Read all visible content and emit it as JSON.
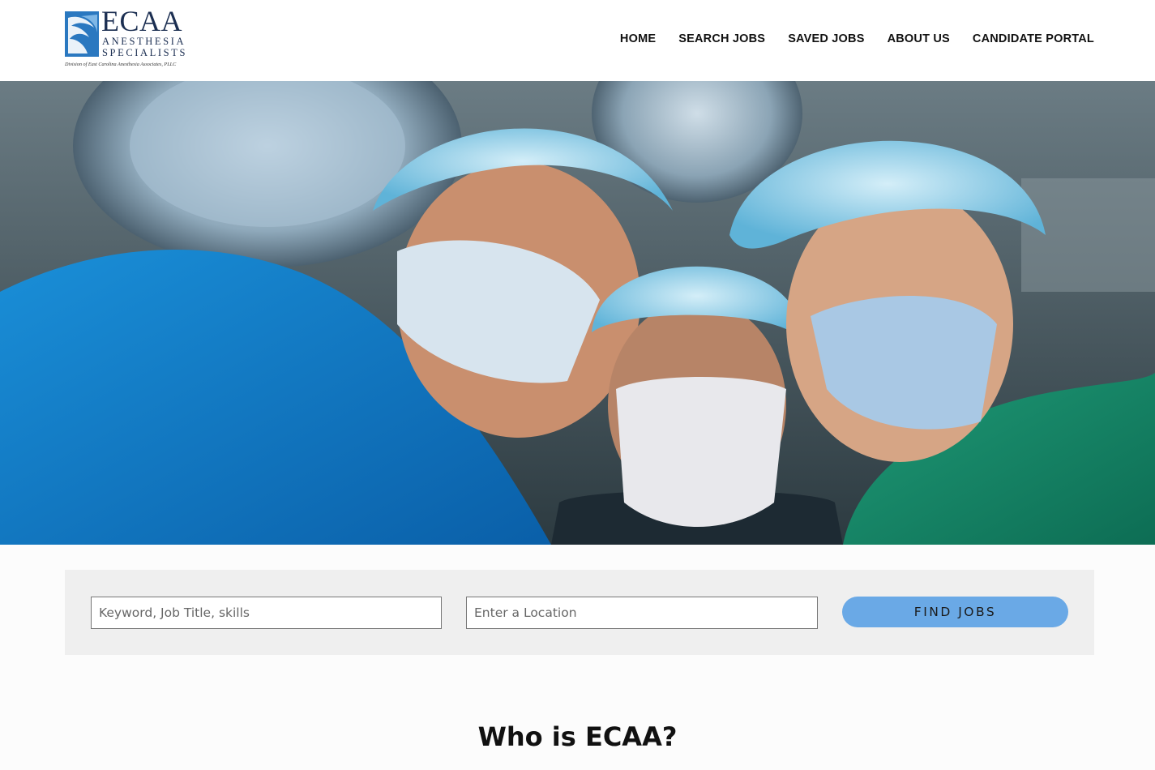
{
  "brand": {
    "wordmark": "ECAA",
    "line1": "ANESTHESIA",
    "line2": "SPECIALISTS",
    "division": "Division of East Carolina Anesthesia Associates, PLLC",
    "colors": {
      "navy": "#1c2f52",
      "blue": "#2a78c0"
    }
  },
  "nav": {
    "items": [
      "HOME",
      "SEARCH JOBS",
      "SAVED JOBS",
      "ABOUT US",
      "CANDIDATE PORTAL"
    ]
  },
  "hero": {
    "description": "Surgical team in scrubs, caps and masks under operating lights",
    "icon": "hero-photo"
  },
  "search": {
    "keyword_placeholder": "Keyword, Job Title, skills",
    "location_placeholder": "Enter a Location",
    "button_label": "FIND JOBS",
    "button_color": "#6aa9e6"
  },
  "sections": {
    "who_title": "Who is ECAA?"
  }
}
